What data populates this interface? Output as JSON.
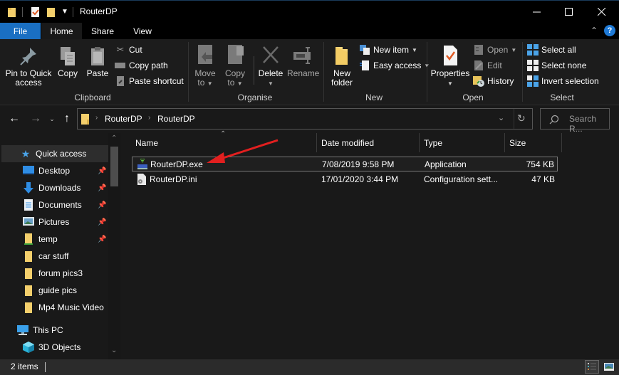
{
  "window": {
    "title": "RouterDP",
    "controls": {
      "minimize": "minimize",
      "maximize": "maximize",
      "close": "close"
    }
  },
  "tabs": [
    {
      "label": "File",
      "active": false,
      "accent": "#1a6fc2"
    },
    {
      "label": "Home",
      "active": true
    },
    {
      "label": "Share",
      "active": false
    },
    {
      "label": "View",
      "active": false
    }
  ],
  "ribbon": {
    "clipboard": {
      "label": "Clipboard",
      "pin_to_quick_access": [
        "Pin to Quick",
        "access"
      ],
      "copy": "Copy",
      "paste": "Paste",
      "cut": "Cut",
      "copy_path": "Copy path",
      "paste_shortcut": "Paste shortcut"
    },
    "organise": {
      "label": "Organise",
      "move_to": [
        "Move",
        "to"
      ],
      "copy_to": [
        "Copy",
        "to"
      ],
      "delete": "Delete",
      "rename": "Rename"
    },
    "new": {
      "label": "New",
      "new_folder": [
        "New",
        "folder"
      ],
      "new_item": "New item",
      "easy_access": "Easy access"
    },
    "open": {
      "label": "Open",
      "properties": "Properties",
      "open": "Open",
      "edit": "Edit",
      "history": "History"
    },
    "select": {
      "label": "Select",
      "select_all": "Select all",
      "select_none": "Select none",
      "invert_selection": "Invert selection"
    }
  },
  "address": {
    "breadcrumb": [
      "RouterDP",
      "RouterDP"
    ],
    "search_placeholder": "Search R..."
  },
  "sidebar": {
    "quick_access": "Quick access",
    "items": [
      {
        "label": "Desktop",
        "icon": "desktop-icon",
        "pinned": true
      },
      {
        "label": "Downloads",
        "icon": "downloads-icon",
        "pinned": true
      },
      {
        "label": "Documents",
        "icon": "documents-icon",
        "pinned": true
      },
      {
        "label": "Pictures",
        "icon": "pictures-icon",
        "pinned": true
      },
      {
        "label": "temp",
        "icon": "folder-icon",
        "pinned": true
      },
      {
        "label": "car stuff",
        "icon": "folder-icon",
        "pinned": false
      },
      {
        "label": "forum pics3",
        "icon": "folder-icon",
        "pinned": false
      },
      {
        "label": "guide pics",
        "icon": "folder-icon",
        "pinned": false
      },
      {
        "label": "Mp4 Music Video",
        "icon": "folder-icon",
        "pinned": false
      }
    ],
    "this_pc": "This PC",
    "pc_items": [
      {
        "label": "3D Objects",
        "icon": "3d-objects-icon"
      }
    ]
  },
  "filelist": {
    "columns": [
      "Name",
      "Date modified",
      "Type",
      "Size"
    ],
    "rows": [
      {
        "name": "RouterDP.exe",
        "date": "7/08/2019 9:58 PM",
        "type": "Application",
        "size": "754 KB",
        "icon": "application-icon",
        "selected": true
      },
      {
        "name": "RouterDP.ini",
        "date": "17/01/2020 3:44 PM",
        "type": "Configuration sett...",
        "size": "47 KB",
        "icon": "config-file-icon",
        "selected": false
      }
    ],
    "annotation_color": "#e21f1f"
  },
  "status": {
    "item_count": "2 items"
  }
}
